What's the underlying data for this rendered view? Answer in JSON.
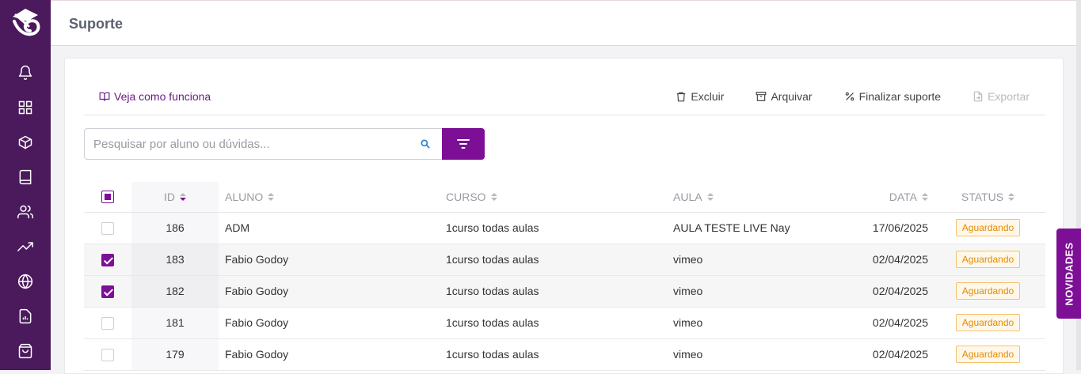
{
  "page": {
    "title": "Suporte"
  },
  "sidebar": {
    "logo_icon": "brand-logo-icon",
    "items": [
      {
        "icon": "bell-icon"
      },
      {
        "icon": "grid-icon"
      },
      {
        "icon": "box-icon"
      },
      {
        "icon": "book-icon"
      },
      {
        "icon": "users-icon"
      },
      {
        "icon": "trending-icon"
      },
      {
        "icon": "globe-icon"
      },
      {
        "icon": "report-icon"
      },
      {
        "icon": "shopping-bag-icon"
      }
    ]
  },
  "toolbar": {
    "howto_label": "Veja como funciona",
    "delete_label": "Excluir",
    "archive_label": "Arquivar",
    "finish_label": "Finalizar suporte",
    "export_label": "Exportar"
  },
  "search": {
    "placeholder": "Pesquisar por aluno ou dúvidas...",
    "value": ""
  },
  "table": {
    "headers": {
      "id": "ID",
      "aluno": "ALUNO",
      "curso": "CURSO",
      "aula": "AULA",
      "data": "DATA",
      "status": "STATUS"
    },
    "rows": [
      {
        "checked": false,
        "id": "186",
        "aluno": "ADM",
        "curso": "1curso todas aulas",
        "aula": "AULA TESTE LIVE Nay",
        "data": "17/06/2025",
        "status": "Aguardando"
      },
      {
        "checked": true,
        "id": "183",
        "aluno": "Fabio Godoy",
        "curso": "1curso todas aulas",
        "aula": "vimeo",
        "data": "02/04/2025",
        "status": "Aguardando"
      },
      {
        "checked": true,
        "id": "182",
        "aluno": "Fabio Godoy",
        "curso": "1curso todas aulas",
        "aula": "vimeo",
        "data": "02/04/2025",
        "status": "Aguardando"
      },
      {
        "checked": false,
        "id": "181",
        "aluno": "Fabio Godoy",
        "curso": "1curso todas aulas",
        "aula": "vimeo",
        "data": "02/04/2025",
        "status": "Aguardando"
      },
      {
        "checked": false,
        "id": "179",
        "aluno": "Fabio Godoy",
        "curso": "1curso todas aulas",
        "aula": "vimeo",
        "data": "02/04/2025",
        "status": "Aguardando"
      }
    ]
  },
  "novidades_label": "NOVIDADES",
  "colors": {
    "brand": "#7d0f96",
    "sidebar": "#4a1a5c",
    "status_warning": "#e38a00"
  }
}
